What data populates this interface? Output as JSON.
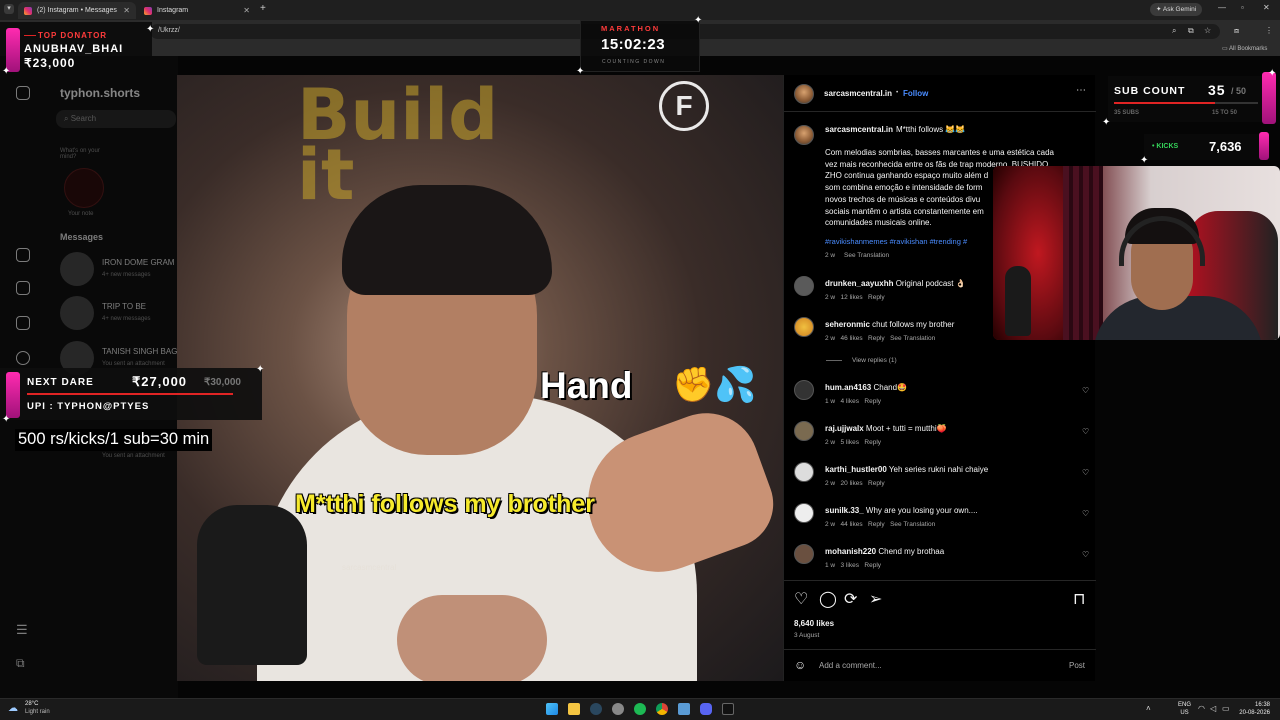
{
  "browser": {
    "tabs": [
      {
        "title": "(2) Instagram • Messages",
        "active": true
      },
      {
        "title": "Instagram",
        "active": false
      }
    ],
    "address": "/Ukrzz/",
    "ask_label": "Ask Gemini",
    "bookmarks_label": "All Bookmarks"
  },
  "instagram_bg": {
    "username": "typhon.shorts",
    "search_placeholder": "Search",
    "note_prompt": "What's on your mind?",
    "your_note": "Your note",
    "messages_title": "Messages",
    "threads": [
      {
        "name": "IRON DOME GRAM",
        "sub": "4+ new messages"
      },
      {
        "name": "TRIP TO BE",
        "sub": "4+ new messages"
      },
      {
        "name": "TANISH SINGH BAG",
        "sub": "You sent an attachment"
      }
    ],
    "last_thread_sub": "You sent an attachment"
  },
  "video": {
    "watermark_letter": "F",
    "caption_top": "Hand",
    "caption_top_emoji": "✊💦",
    "caption_main": "M*tthi  follows my brother",
    "credit": "sarcasmcentral"
  },
  "post": {
    "author": "sarcasmcentral.in",
    "follow_label": "Follow",
    "caption_title": "M*tthi follows 😹😹",
    "caption_body": "Com melodias sombrias, basses marcantes e uma estética cada vez mais reconhecida entre os fãs de trap moderno, BUSHIDO ZHO continua ganhando espaço muito além d... som combina emoção e intensidade de form... novos trechos de músicas e conteúdos divu... sociais mantêm o artista constantemente em... comunidades musicais online.",
    "caption_lines": [
      "Com melodias sombrias, basses marcantes e uma estética cada",
      "vez mais reconhecida entre os fãs de trap moderno, BUSHIDO",
      "ZHO continua ganhando espaço muito além d",
      "som combina emoção e intensidade de form",
      "novos trechos de músicas e conteúdos divu",
      "sociais mantêm o artista constantemente em",
      "comunidades musicais online."
    ],
    "hashtags": "#ravikishanmemes #ravikishan #trending #",
    "caption_age": "2 w",
    "see_translation": "See Translation",
    "view_replies": "View replies (1)",
    "comments": [
      {
        "user": "drunken_aayuxhh",
        "text": "Original podcast 👌🏻",
        "age": "2 w",
        "likes": "12 likes",
        "reply": "Reply",
        "translate": ""
      },
      {
        "user": "seheronmic",
        "text": "chut follows my brother",
        "age": "2 w",
        "likes": "46 likes",
        "reply": "Reply",
        "translate": "See Translation"
      },
      {
        "user": "hum.an4163",
        "text": "Chand🤩",
        "age": "1 w",
        "likes": "4 likes",
        "reply": "Reply",
        "translate": ""
      },
      {
        "user": "raj.ujjwalx",
        "text": "Moot + tutti = mutthi🍑",
        "age": "2 w",
        "likes": "5 likes",
        "reply": "Reply",
        "translate": ""
      },
      {
        "user": "karthi_hustler00",
        "text": "Yeh series rukni nahi chaiye",
        "age": "2 w",
        "likes": "20 likes",
        "reply": "Reply",
        "translate": ""
      },
      {
        "user": "sunilk.33_",
        "text": "Why are you losing your own....",
        "age": "2 w",
        "likes": "44 likes",
        "reply": "Reply",
        "translate": "See Translation"
      },
      {
        "user": "mohanish220",
        "text": "Chend my brothaa",
        "age": "1 w",
        "likes": "3 likes",
        "reply": "Reply",
        "translate": ""
      }
    ],
    "like_count": "8,640 likes",
    "date": "3 August",
    "add_comment_placeholder": "Add a comment...",
    "post_label": "Post"
  },
  "overlays": {
    "top_donator_label": "TOP DONATOR",
    "top_donator_name": "ANUBHAV_BHAI",
    "top_donator_amount": "₹23,000",
    "marathon_label": "MARATHON",
    "marathon_time": "15:02:23",
    "marathon_sub": "COUNTING DOWN",
    "next_dare_label": "NEXT DARE",
    "next_dare_amount": "₹27,000",
    "next_dare_goal": "₹30,000",
    "upi": "UPI : TYPHON@PTYES",
    "rate_text": "500 rs/kicks/1 sub=30 min",
    "sub_count_label": "SUB COUNT",
    "sub_count_value": "35",
    "sub_count_goal": "/ 50",
    "sub_meta_left": "35 SUBS",
    "sub_meta_right": "15 TO 50",
    "sub_progress": 0.7,
    "kicks_label": "• KICKS",
    "kicks_value": "7,636"
  },
  "taskbar": {
    "weather_temp": "28°C",
    "weather_desc": "Light rain",
    "lang": "ENG",
    "region": "US",
    "time": "16:38",
    "date": "20-08-2026"
  },
  "colors": {
    "accent_pink": "#ff2bb0",
    "caption_yellow": "#f6ea2c",
    "link_blue": "#4a8cff",
    "overlay_red": "#e02424"
  }
}
